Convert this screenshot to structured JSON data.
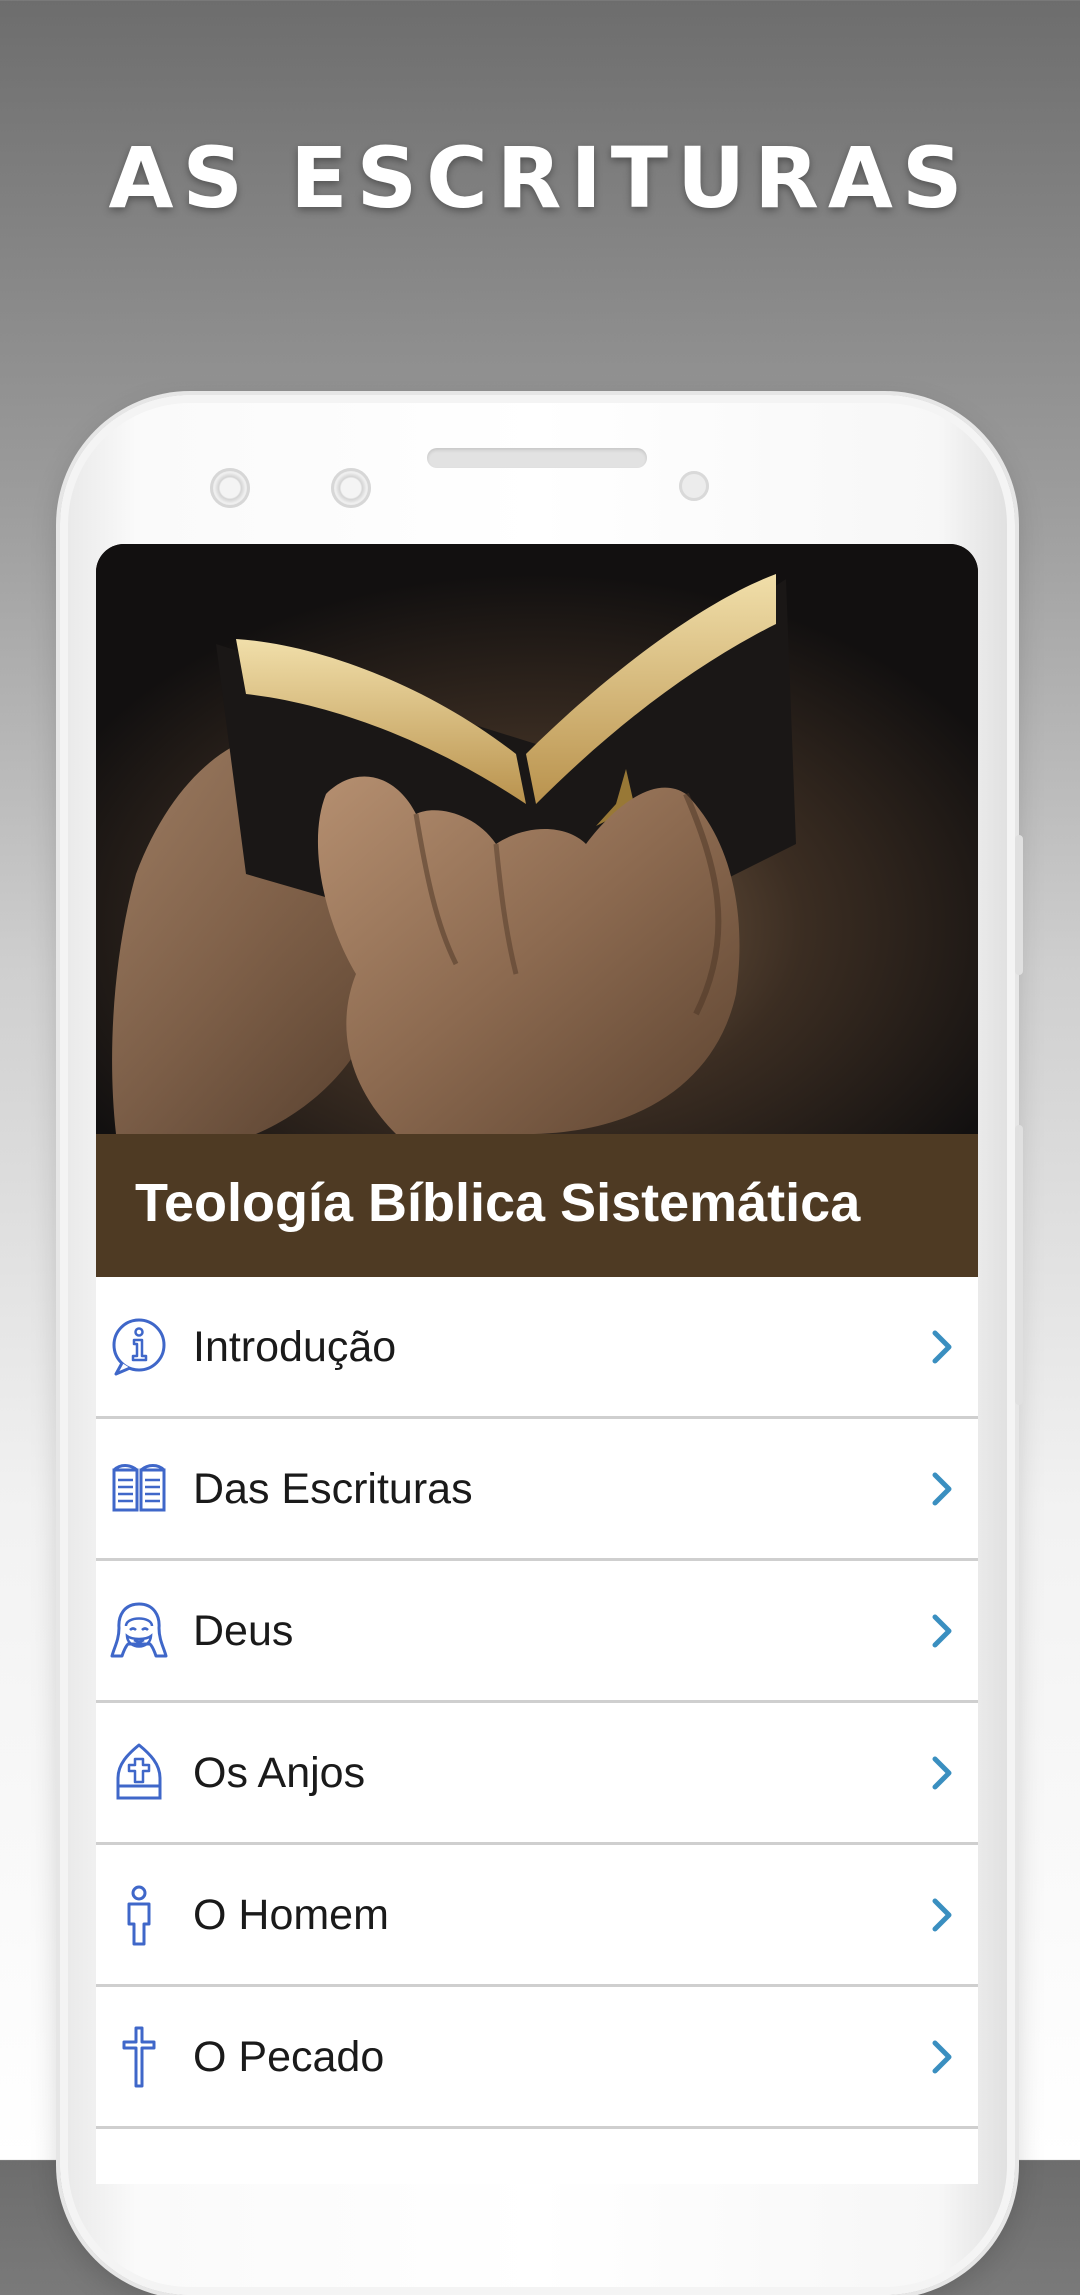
{
  "promo": {
    "title": "AS ESCRITURAS"
  },
  "app": {
    "header_title": "Teología Bíblica Sistemática",
    "header_image": "hands-holding-open-bible-photo",
    "accent_color": "#4e3a23",
    "icon_color": "#3f67c9",
    "chevron_color": "#3a8fc0"
  },
  "menu": {
    "items": [
      {
        "label": "Introdução",
        "icon": "info-speech-icon"
      },
      {
        "label": "Das Escrituras",
        "icon": "open-book-icon"
      },
      {
        "label": "Deus",
        "icon": "bearded-face-icon"
      },
      {
        "label": "Os Anjos",
        "icon": "mitre-cross-icon"
      },
      {
        "label": "O Homem",
        "icon": "person-icon"
      },
      {
        "label": "O Pecado",
        "icon": "cross-icon"
      }
    ]
  }
}
